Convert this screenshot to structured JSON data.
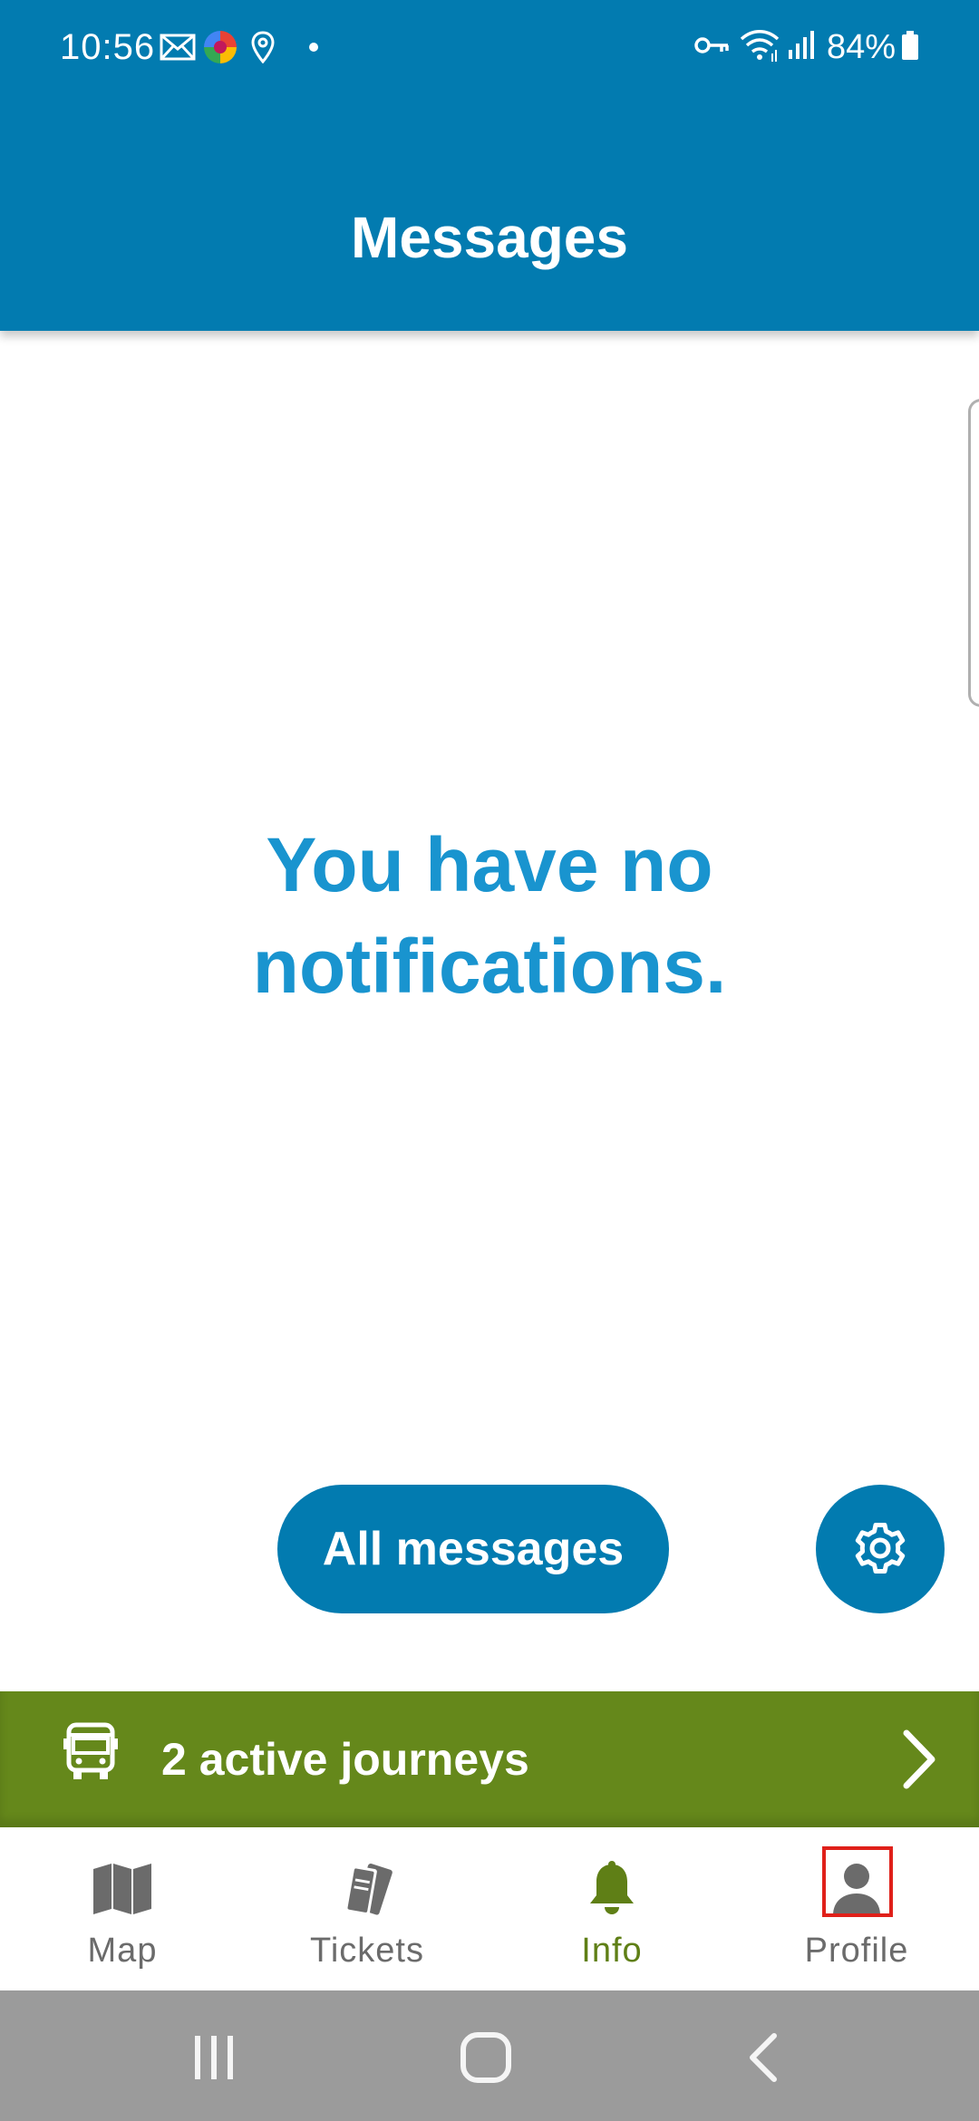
{
  "status_bar": {
    "time": "10:56",
    "battery": "84%",
    "left_icons": [
      "mail-icon",
      "photos-app-icon",
      "location-icon",
      "dot-icon"
    ],
    "right_icons": [
      "vpn-key-icon",
      "wifi-icon",
      "signal-icon",
      "battery-icon"
    ]
  },
  "header": {
    "title": "Messages"
  },
  "empty_state": {
    "line1": "You have no",
    "line2": "notifications."
  },
  "actions": {
    "all_messages_label": "All messages",
    "settings_icon": "gear-icon"
  },
  "journeys_banner": {
    "label": "2 active journeys",
    "icon": "bus-icon"
  },
  "bottom_nav": {
    "items": [
      {
        "label": "Map",
        "icon": "map-icon"
      },
      {
        "label": "Tickets",
        "icon": "tickets-icon"
      },
      {
        "label": "Info",
        "icon": "bell-icon",
        "active": true
      },
      {
        "label": "Profile",
        "icon": "person-icon"
      }
    ]
  },
  "colors": {
    "header_blue": "#027bb0",
    "text_blue": "#1994cf",
    "journeys_green": "#65881b",
    "active_nav": "#5f7f16",
    "inactive_nav": "#6b6b6b",
    "system_nav": "#9b9b9b"
  }
}
